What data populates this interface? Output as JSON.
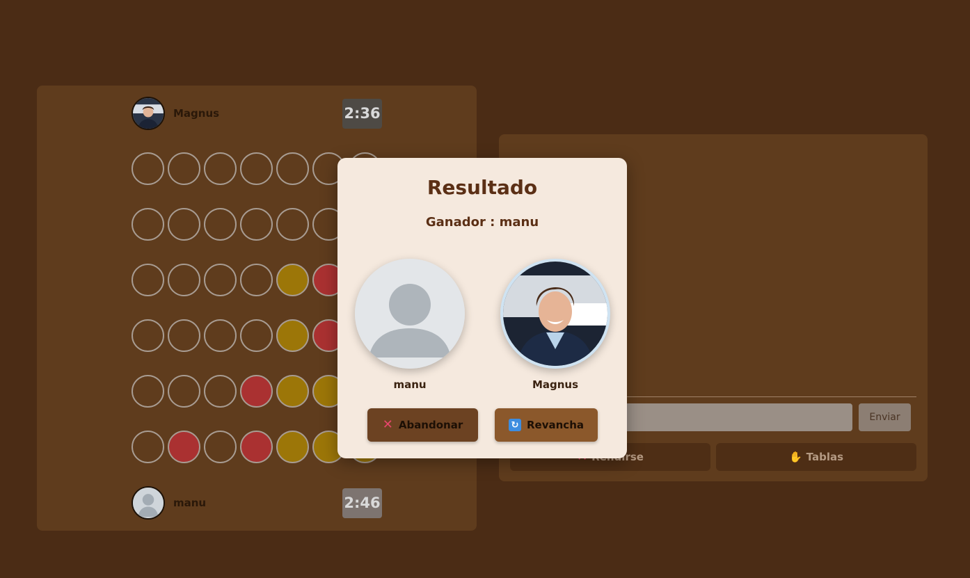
{
  "game": {
    "opponent": {
      "name": "Magnus",
      "clock": "2:36"
    },
    "player": {
      "name": "manu",
      "clock": "2:46"
    },
    "board": {
      "rows": 6,
      "columns": 7,
      "cells": [
        [
          "empty",
          "empty",
          "empty",
          "empty",
          "empty",
          "empty",
          "empty"
        ],
        [
          "empty",
          "empty",
          "empty",
          "empty",
          "empty",
          "empty",
          "empty"
        ],
        [
          "empty",
          "empty",
          "empty",
          "empty",
          "yellow",
          "red",
          "empty"
        ],
        [
          "empty",
          "empty",
          "empty",
          "empty",
          "yellow",
          "red",
          "empty"
        ],
        [
          "empty",
          "empty",
          "empty",
          "red",
          "yellow",
          "yellow",
          "empty"
        ],
        [
          "empty",
          "red",
          "empty",
          "red",
          "yellow",
          "yellow",
          "yellow"
        ]
      ]
    }
  },
  "chat": {
    "input_placeholder": "",
    "send_label": "Enviar",
    "resign_label": "Rendirse",
    "draw_label": "Tablas"
  },
  "modal": {
    "title": "Resultado",
    "winner_text": "Ganador : manu",
    "left_player": "manu",
    "right_player": "Magnus",
    "abandon_label": "Abandonar",
    "rematch_label": "Revancha"
  },
  "icons": {
    "abandon": "x-icon",
    "rematch": "refresh-icon",
    "resign": "x-icon",
    "draw": "handshake-icon"
  },
  "colors": {
    "background": "#4b2c15",
    "panel": "#5f3c1d",
    "modal": "#f5e9de",
    "red_piece": "#aa3131",
    "yellow_piece": "#9c7608"
  }
}
